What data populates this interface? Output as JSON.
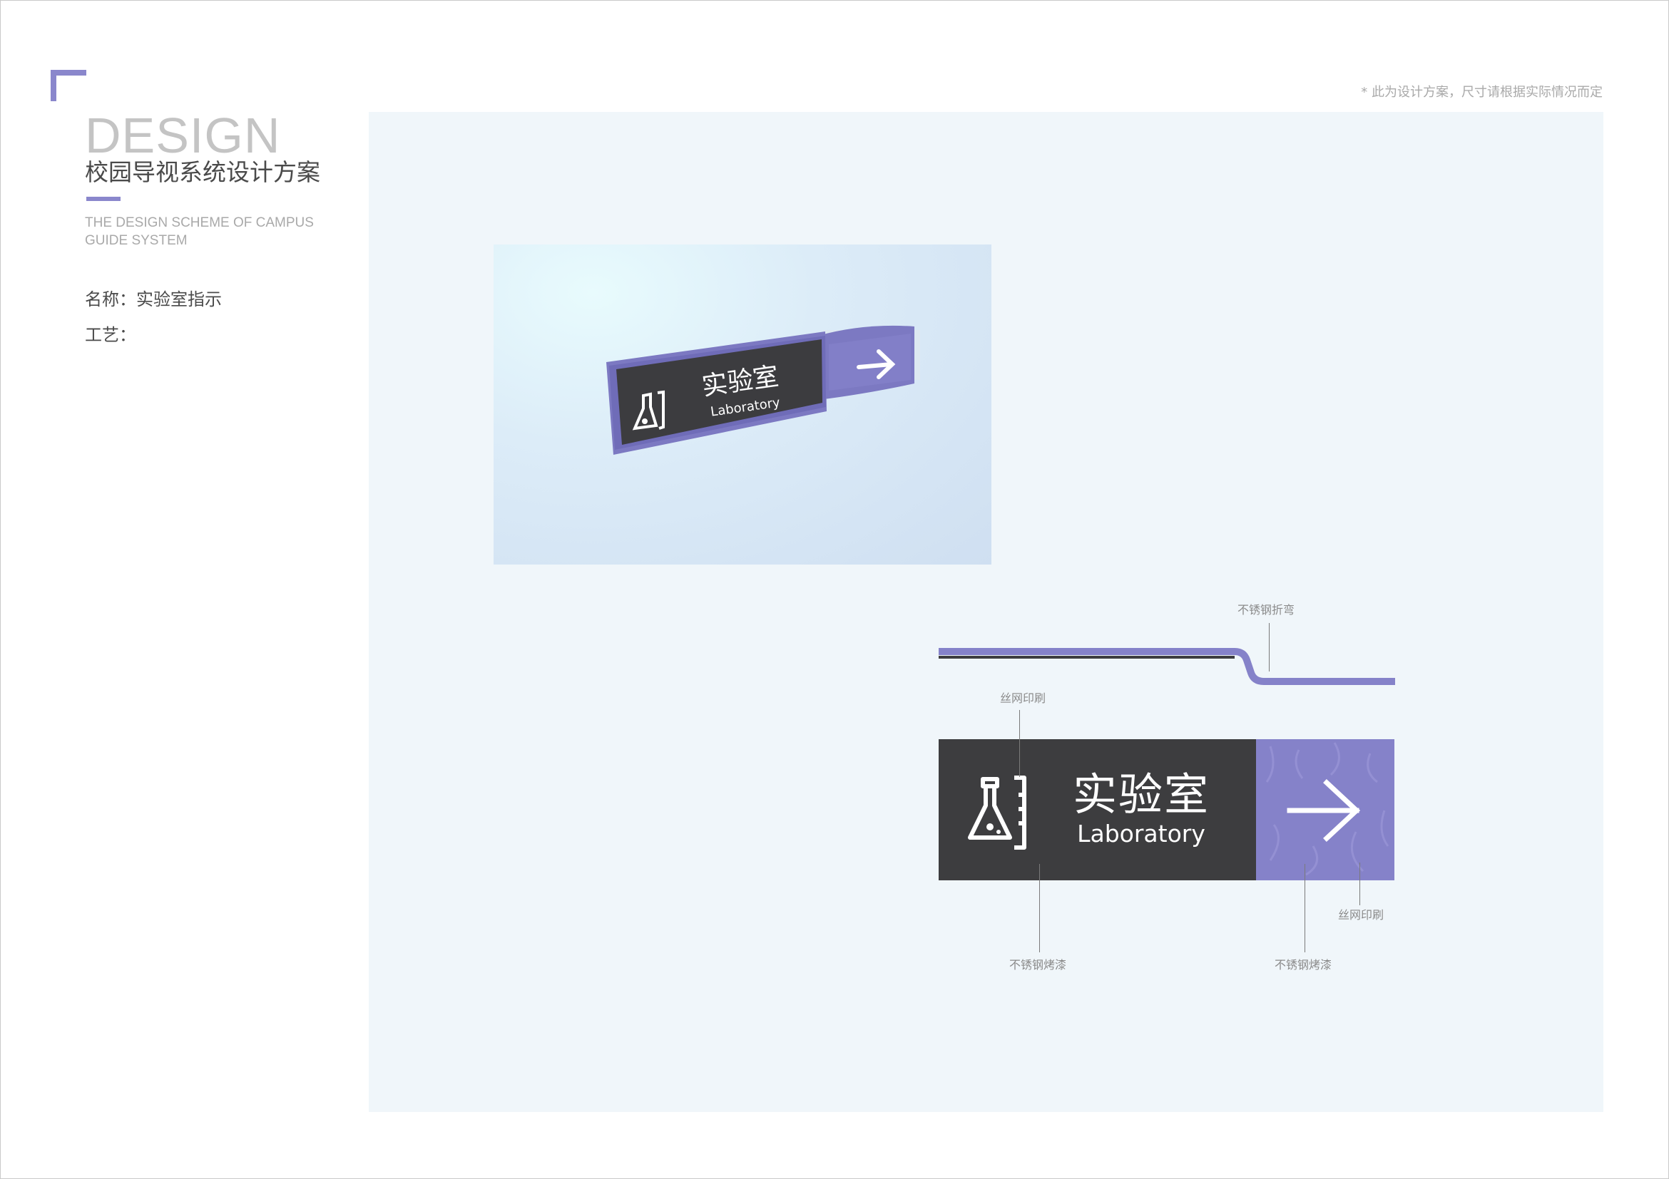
{
  "header": {
    "big_title": "DESIGN",
    "cn_title": "校园导视系统设计方案",
    "en_subtitle_line1": "THE DESIGN SCHEME OF CAMPUS",
    "en_subtitle_line2": "GUIDE SYSTEM",
    "note": "* 此为设计方案，尺寸请根据实际情况而定"
  },
  "info": {
    "name_line": "名称：实验室指示",
    "craft_line": "工艺："
  },
  "render": {
    "sign_cn": "实验室",
    "sign_en": "Laboratory"
  },
  "drawing": {
    "sign_cn": "实验室",
    "sign_en": "Laboratory",
    "callouts": {
      "top_bend": "不锈钢折弯",
      "screen_print_left": "丝网印刷",
      "screen_print_right": "丝网印刷",
      "paint_left": "不锈钢烤漆",
      "paint_right": "不锈钢烤漆"
    }
  },
  "colors": {
    "accent": "#8a87cc",
    "plate_dark": "#3d3d3f",
    "plate_purple": "#8582c9",
    "panel_bg": "#f0f6fa"
  }
}
